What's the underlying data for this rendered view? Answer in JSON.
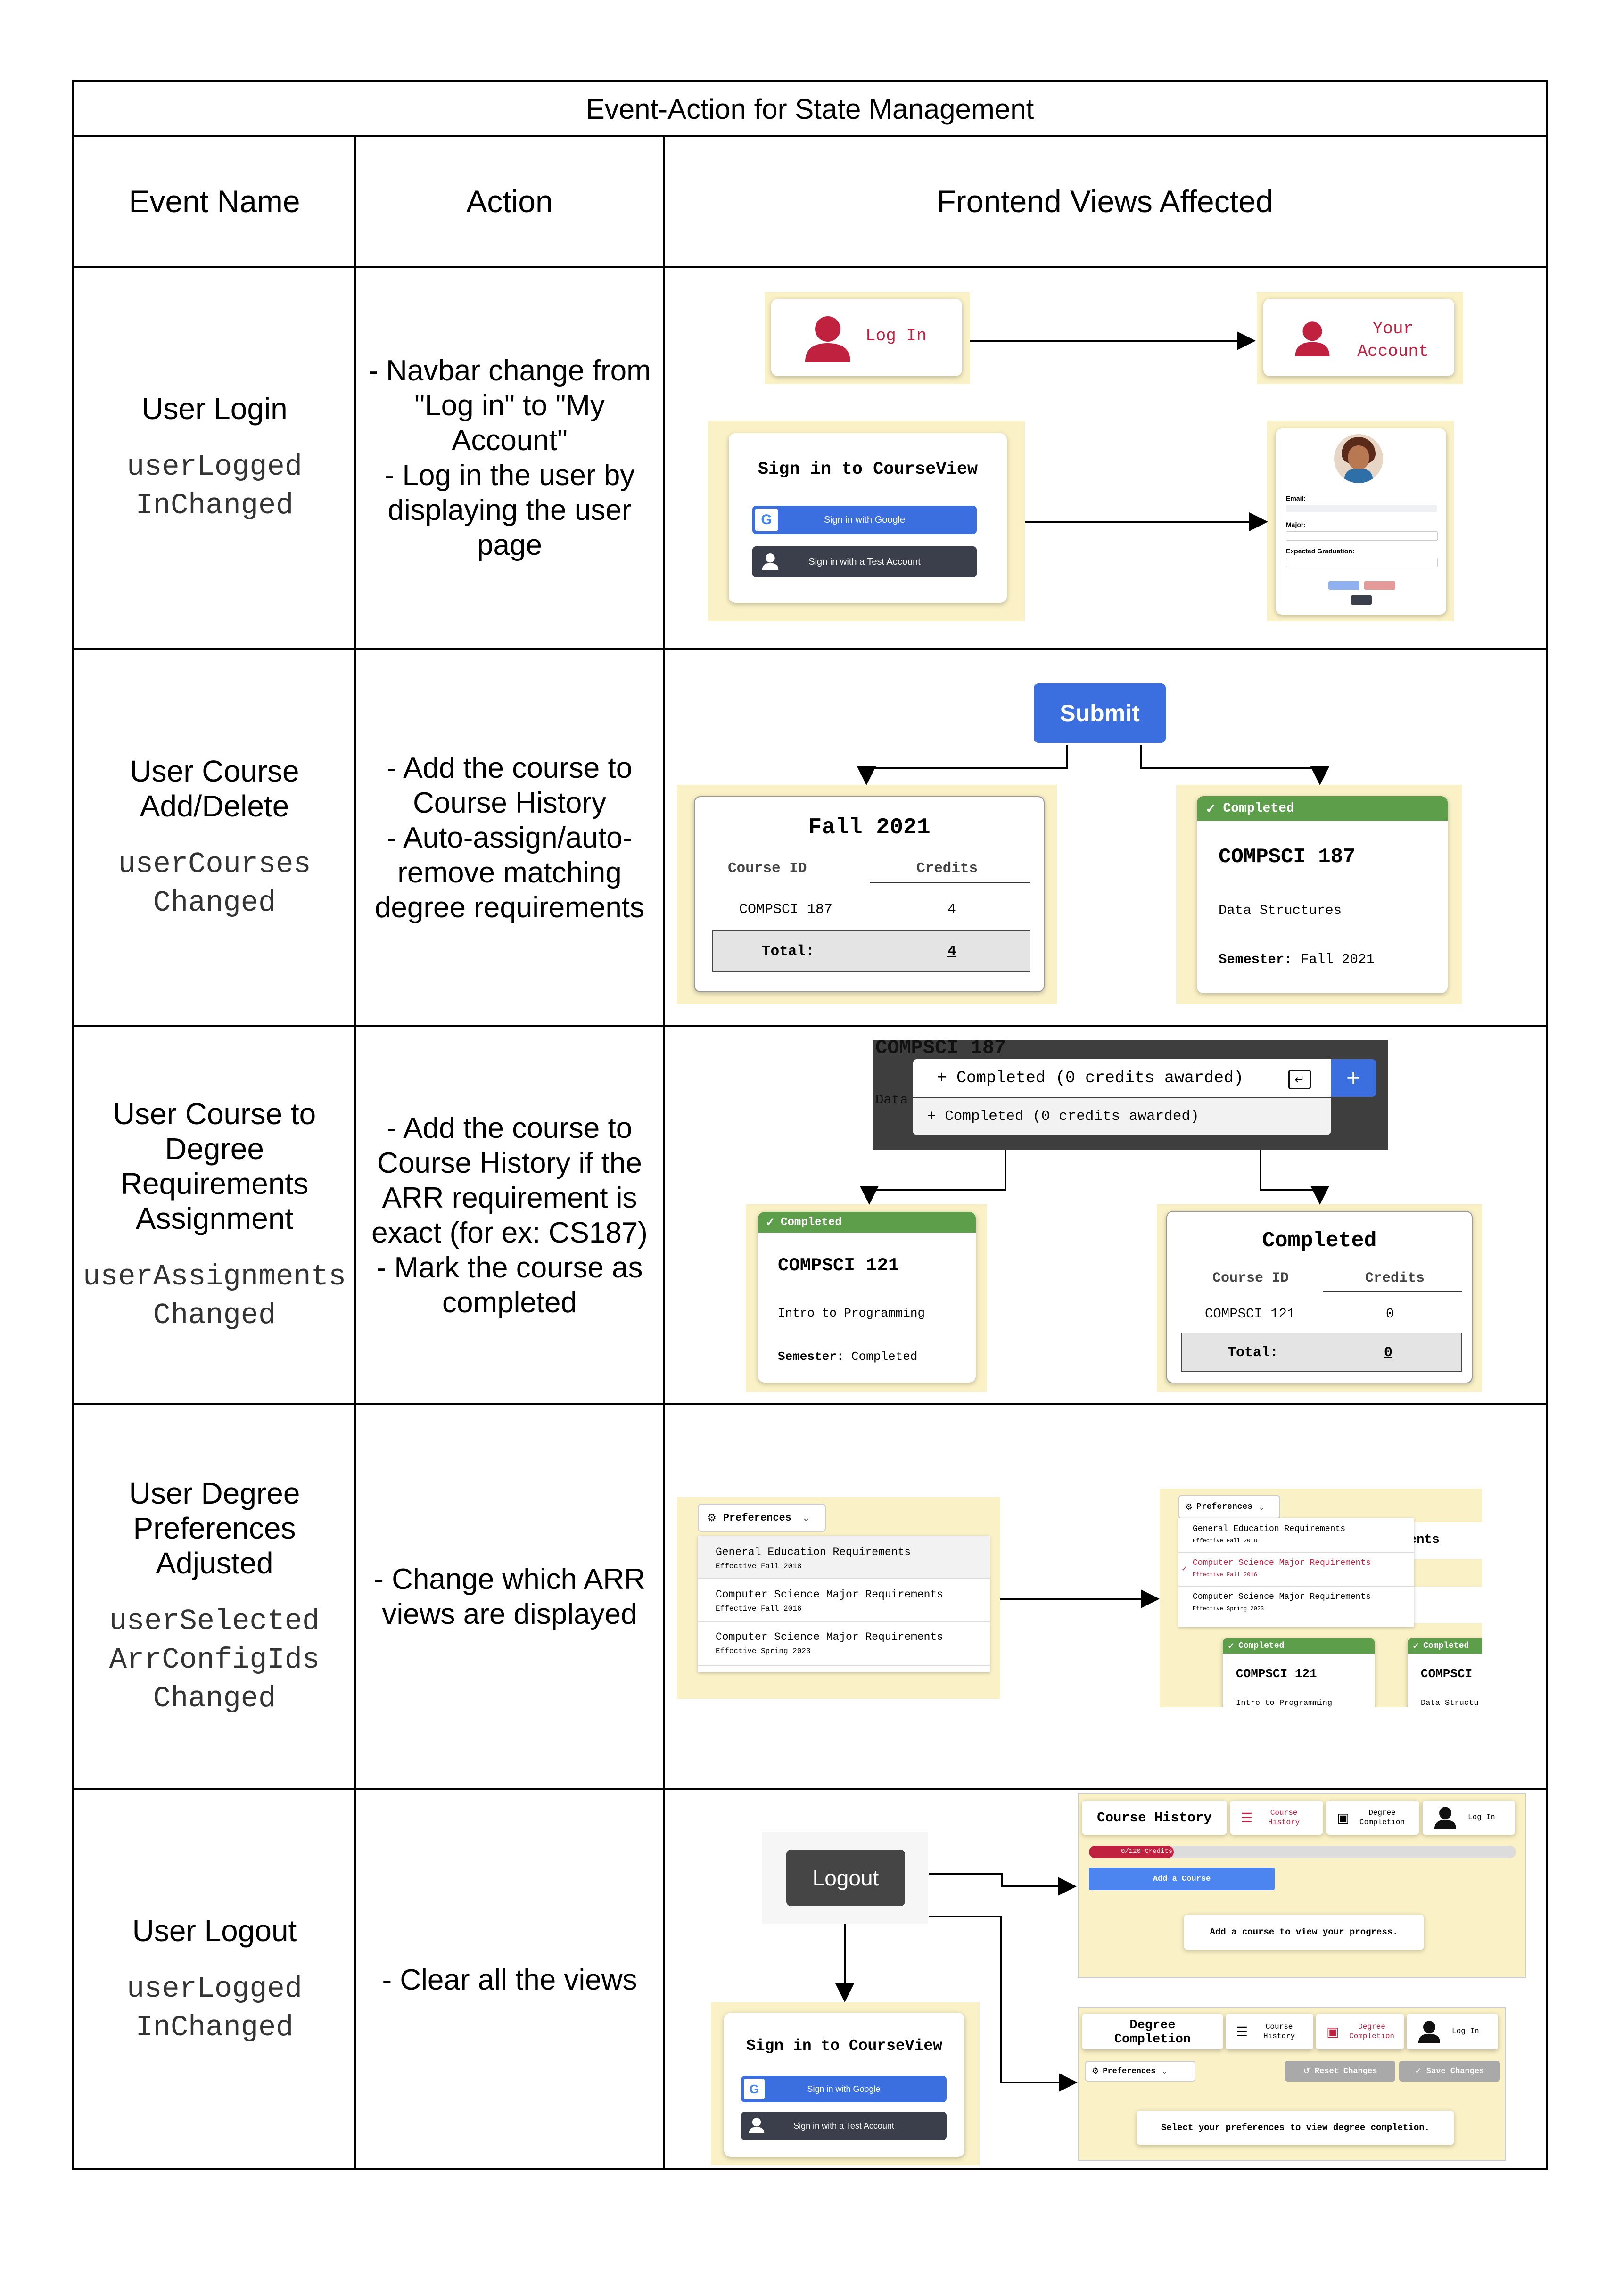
{
  "table": {
    "title": "Event-Action for State Management",
    "headers": {
      "event": "Event Name",
      "action": "Action",
      "views": "Frontend Views Affected"
    }
  },
  "rows": [
    {
      "event_name": "User Login",
      "event_var_1": "userLogged",
      "event_var_2": "InChanged",
      "action_lines": [
        "- Navbar change from",
        "\"Log in\" to \"My",
        "Account\"",
        "- Log in the user by",
        "displaying the user",
        "page"
      ]
    },
    {
      "event_name_lines": [
        "User Course",
        "Add/Delete"
      ],
      "event_var_1": "userCourses",
      "event_var_2": "Changed",
      "action_lines": [
        "- Add the course to",
        "Course History",
        "- Auto-assign/auto-",
        "remove matching",
        "degree requirements"
      ]
    },
    {
      "event_name_lines": [
        "User Course to",
        "Degree",
        "Requirements",
        "Assignment"
      ],
      "event_var_1": "userAssignments",
      "event_var_2": "Changed",
      "action_lines": [
        "- Add the course to",
        "Course History if the",
        "ARR requirement is",
        "exact (for ex: CS187)",
        "- Mark the course as",
        "completed"
      ]
    },
    {
      "event_name_lines": [
        "User Degree",
        "Preferences",
        "Adjusted"
      ],
      "event_var_1": "userSelected",
      "event_var_2": "ArrConfigIds",
      "event_var_3": "Changed",
      "action_lines": [
        "- Change which ARR",
        "views are displayed"
      ]
    },
    {
      "event_name": "User Logout",
      "event_var_1": "userLogged",
      "event_var_2": "InChanged",
      "action_lines": [
        "- Clear all the views"
      ]
    }
  ],
  "views": {
    "login_button": "Log In",
    "your_account_1": "Your",
    "your_account_2": "Account",
    "signin_title": "Sign in to CourseView",
    "signin_google": "Sign in with Google",
    "signin_test": "Sign in with a Test Account",
    "profile_email": "Email:",
    "profile_major": "Major:",
    "profile_grad": "Expected Graduation:",
    "submit": "Submit",
    "semester_fall2021": "Fall 2021",
    "col_course_id": "Course ID",
    "col_credits": "Credits",
    "row_compsci187": "COMPSCI 187",
    "row_credits_4": "4",
    "total_label": "Total:",
    "total_4": "4",
    "badge_completed": "Completed",
    "card_187_title": "COMPSCI 187",
    "card_187_desc": "Data Structures",
    "card_187_sem_label": "Semester:",
    "card_187_sem": "Fall 2021",
    "dropdown_bg_title": "COMPSCI 187",
    "dropdown_bg_data": "Data",
    "dropdown_input": "+ Completed (0 credits awarded)",
    "dropdown_option": "+ Completed (0 credits awarded)",
    "plus": "+",
    "card_121_title": "COMPSCI 121",
    "card_121_desc": "Intro to Programming",
    "card_121_sem_label": "Semester:",
    "card_121_sem": "Completed",
    "completed_table_title": "Completed",
    "row_compsci121": "COMPSCI 121",
    "row_credits_0": "0",
    "total_0": "0",
    "preferences": "Preferences",
    "pref_items": [
      {
        "name": "General Education Requirements",
        "eff": "Effective Fall 2018"
      },
      {
        "name": "Computer Science Major Requirements",
        "eff": "Effective Fall 2016"
      },
      {
        "name": "Computer Science Major Requirements",
        "eff": "Effective Spring 2023"
      }
    ],
    "pref_after_peek": "uirements",
    "pref_after_peek2": "s",
    "pref_after_card1": "COMPSCI 121",
    "pref_after_card1_desc": "Intro to Programming",
    "pref_after_card2": "COMPSCI",
    "pref_after_card2_desc": "Data Structu",
    "logout": "Logout",
    "nav_course_history": "Course History",
    "nav_course_history_small_1": "Course",
    "nav_course_history_small_2": "History",
    "nav_degree_1": "Degree",
    "nav_degree_2": "Completion",
    "nav_login": "Log In",
    "progress_label": "0/120 Credits",
    "progress_value": 0,
    "add_course": "Add a Course",
    "empty_history": "Add a course to view your progress.",
    "degree_title_1": "Degree",
    "degree_title_2": "Completion",
    "reset_changes": "Reset Changes",
    "save_changes": "Save Changes",
    "empty_degree": "Select your preferences to view degree completion."
  },
  "colors": {
    "highlight": "#faf1c6",
    "accent_red": "#c0213f",
    "button_blue": "#3b6fe0",
    "badge_green": "#5c9e4a",
    "dark_button": "#3a3f4b"
  }
}
